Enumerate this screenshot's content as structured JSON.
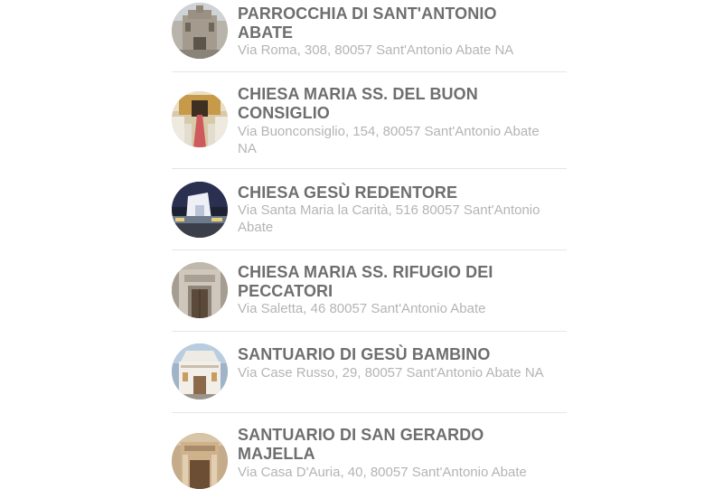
{
  "churches": [
    {
      "name": "PARROCCHIA DI SANT'ANTONIO ABATE",
      "address": "Via Roma, 308, 80057 Sant'Antonio Abate NA",
      "photo": "church-photo"
    },
    {
      "name": "CHIESA MARIA SS. DEL BUON CONSIGLIO",
      "address": "Via Buonconsiglio, 154, 80057 Sant'Antonio Abate NA",
      "photo": "church-interior-photo"
    },
    {
      "name": "CHIESA GESÙ REDENTORE",
      "address": "Via Santa Maria la Carità, 516 80057 Sant'Antonio Abate",
      "photo": "church-night-photo"
    },
    {
      "name": "CHIESA MARIA SS. RIFUGIO DEI PECCATORI",
      "address": "Via Saletta, 46 80057 Sant'Antonio Abate",
      "photo": "church-door-photo"
    },
    {
      "name": "SANTUARIO DI GESÙ BAMBINO",
      "address": "Via Case Russo, 29, 80057 Sant'Antonio Abate NA",
      "photo": "church-facade-photo"
    },
    {
      "name": "SANTUARIO DI SAN GERARDO MAJELLA",
      "address": "Via Casa D'Auria, 40, 80057 Sant'Antonio Abate",
      "photo": "church-facade-photo"
    }
  ]
}
